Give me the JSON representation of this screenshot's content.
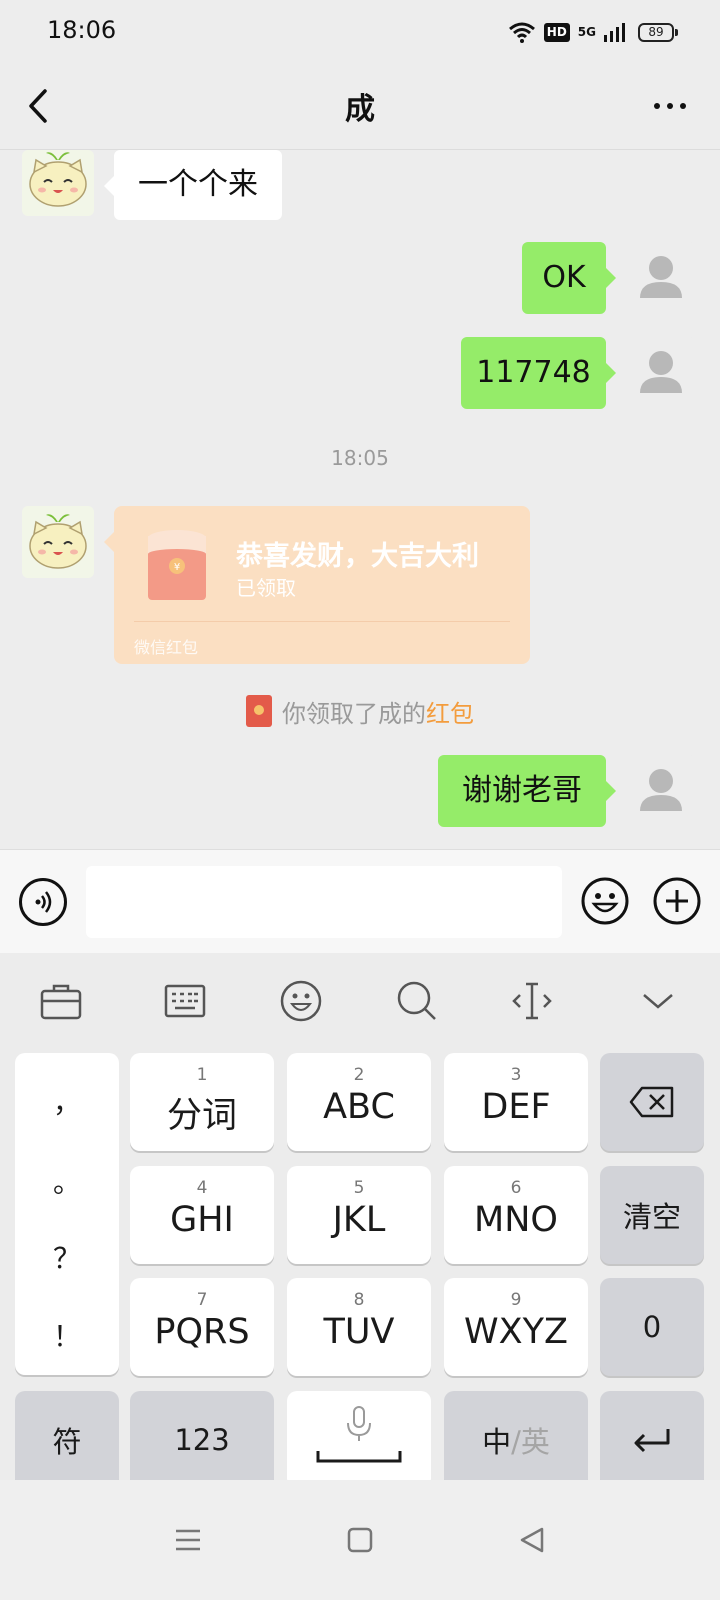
{
  "status_bar": {
    "time": "18:06",
    "network": "5G",
    "hd": "HD",
    "battery": "89"
  },
  "header": {
    "title": "成"
  },
  "messages": [
    {
      "side": "left",
      "text": "一个个来"
    },
    {
      "side": "right",
      "text": "OK"
    },
    {
      "side": "right",
      "text": "117748"
    },
    {
      "side": "right",
      "text": "谢谢老哥"
    }
  ],
  "timestamp": "18:05",
  "red_packet": {
    "title": "恭喜发财，大吉大利",
    "status": "已领取",
    "footer": "微信红包",
    "symbol": "¥"
  },
  "system_notice": {
    "prefix": "你领取了成的",
    "link": "红包"
  },
  "input_bar": {
    "placeholder": ""
  },
  "keyboard": {
    "toolbar": [
      "toolbox-icon",
      "keyboard-icon",
      "emoji-icon",
      "search-icon",
      "cursor-icon",
      "collapse-icon"
    ],
    "punctuation": [
      "，",
      "。",
      "？",
      "！"
    ],
    "keys": [
      {
        "num": "1",
        "label": "分词"
      },
      {
        "num": "2",
        "label": "ABC"
      },
      {
        "num": "3",
        "label": "DEF"
      },
      {
        "num": "4",
        "label": "GHI"
      },
      {
        "num": "5",
        "label": "JKL"
      },
      {
        "num": "6",
        "label": "MNO"
      },
      {
        "num": "7",
        "label": "PQRS"
      },
      {
        "num": "8",
        "label": "TUV"
      },
      {
        "num": "9",
        "label": "WXYZ"
      }
    ],
    "clear_label": "清空",
    "zero_label": "0",
    "symbols_label": "符",
    "numbers_label": "123",
    "lang_cn": "中",
    "lang_sep_en": "/英"
  },
  "colors": {
    "sent_bubble": "#95ec69",
    "received_bubble": "#ffffff",
    "red_packet": "#fbdfc2",
    "link": "#f39c3d"
  }
}
